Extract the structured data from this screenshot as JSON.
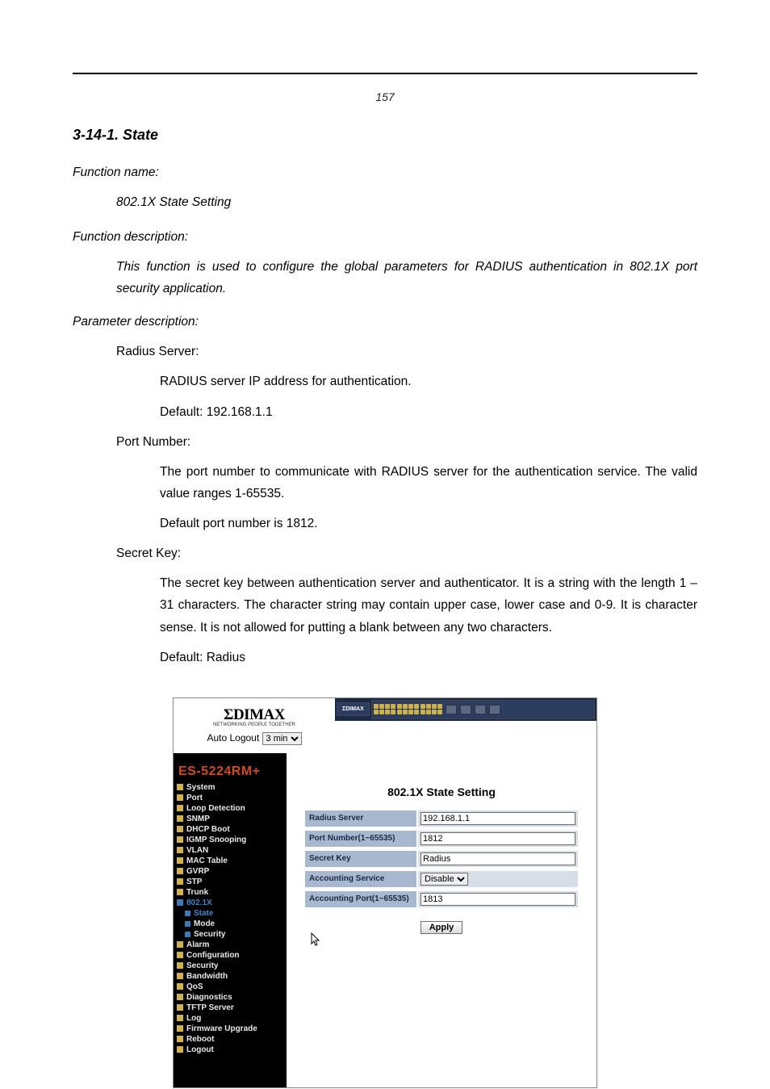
{
  "page_number": "157",
  "section_heading": "3-14-1. State",
  "func_label": "Function name:",
  "func_name": "802.1X State Setting",
  "func_desc_label": "Function description:",
  "func_desc": "This function is used to configure the global parameters for RADIUS authentication in 802.1X port security application.",
  "param_label": "Parameter description:",
  "params": {
    "radius_server": {
      "name": "Radius Server:",
      "desc": "RADIUS server IP address for authentication.",
      "default": "Default: 192.168.1.1"
    },
    "port_number": {
      "name": "Port Number:",
      "desc": "The port number to communicate with RADIUS server for the authentication service. The valid value ranges 1-65535.",
      "default": "Default port number is 1812."
    },
    "secret_key": {
      "name": "Secret Key:",
      "desc_part1": "The secret key between authentication server and authenticator. It is a string with the length 1 – 31 characters. The character string may contain upper case, lower case and 0-9. It is character sense. It is not allowed for putting a blank between any two characters.",
      "default": "Default: Radius"
    }
  },
  "screenshot": {
    "logo": "ΣDIMAX",
    "logo_sub": "NETWORKING PEOPLE TOGETHER",
    "auto_logout_label": "Auto Logout",
    "auto_logout_value": "3 min",
    "hdr_brand": "ΣDIMAX",
    "model": "ES-5224RM+",
    "nav": [
      {
        "label": "System",
        "cls": ""
      },
      {
        "label": "Port",
        "cls": ""
      },
      {
        "label": "Loop Detection",
        "cls": ""
      },
      {
        "label": "SNMP",
        "cls": ""
      },
      {
        "label": "DHCP Boot",
        "cls": ""
      },
      {
        "label": "IGMP Snooping",
        "cls": ""
      },
      {
        "label": "VLAN",
        "cls": ""
      },
      {
        "label": "MAC Table",
        "cls": ""
      },
      {
        "label": "GVRP",
        "cls": ""
      },
      {
        "label": "STP",
        "cls": ""
      },
      {
        "label": "Trunk",
        "cls": ""
      },
      {
        "label": "802.1X",
        "cls": "active-parent blue"
      },
      {
        "label": "State",
        "cls": "sub active blue"
      },
      {
        "label": "Mode",
        "cls": "sub blue"
      },
      {
        "label": "Security",
        "cls": "sub blue"
      },
      {
        "label": "Alarm",
        "cls": ""
      },
      {
        "label": "Configuration",
        "cls": ""
      },
      {
        "label": "Security",
        "cls": ""
      },
      {
        "label": "Bandwidth",
        "cls": ""
      },
      {
        "label": "QoS",
        "cls": ""
      },
      {
        "label": "Diagnostics",
        "cls": ""
      },
      {
        "label": "TFTP Server",
        "cls": ""
      },
      {
        "label": "Log",
        "cls": ""
      },
      {
        "label": "Firmware Upgrade",
        "cls": ""
      },
      {
        "label": "Reboot",
        "cls": ""
      },
      {
        "label": "Logout",
        "cls": ""
      }
    ],
    "panel_title": "802.1X State Setting",
    "form": {
      "radius_server": {
        "label": "Radius Server",
        "value": "192.168.1.1"
      },
      "port_number": {
        "label": "Port Number(1~65535)",
        "value": "1812"
      },
      "secret_key": {
        "label": "Secret Key",
        "value": "Radius"
      },
      "accounting_service": {
        "label": "Accounting Service",
        "value": "Disable"
      },
      "accounting_port": {
        "label": "Accounting Port(1~65535)",
        "value": "1813"
      }
    },
    "apply": "Apply"
  }
}
